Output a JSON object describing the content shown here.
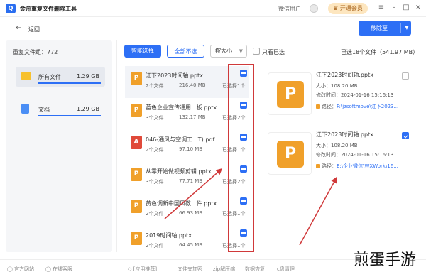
{
  "titlebar": {
    "app_title": "金舟重复文件删除工具",
    "logo_text": "Q",
    "user_label": "微信用户",
    "vip_label": "开通会员",
    "icons": [
      "menu-icon",
      "minimize-icon",
      "maximize-icon",
      "close-icon"
    ]
  },
  "nav": {
    "back_label": "返回",
    "move_label": "移除至"
  },
  "sidebar": {
    "dup_count": "重复文件组：772",
    "categories": [
      {
        "label": "所有文件",
        "size": "1.29 GB",
        "icon": "folder-icon",
        "progress": 1.0
      },
      {
        "label": "文档",
        "size": "1.29 GB",
        "icon": "document-icon",
        "progress": 1.0
      }
    ]
  },
  "toolbar": {
    "smart_select": "智能选择",
    "deselect_all": "全部不选",
    "sort_by": "按大小",
    "only_selected": "只看已选",
    "summary": "已选18个文件（541.97 MB）"
  },
  "files": [
    {
      "name": "江下2023时间轴.pptx",
      "count": "2个文件",
      "size": "216.40 MB",
      "selected": "已选择1个",
      "type": "ppt"
    },
    {
      "name": "蓝色企业宣传通用...板.pptx",
      "count": "3个文件",
      "size": "132.17 MB",
      "selected": "已选择2个",
      "type": "ppt"
    },
    {
      "name": "046-通风与空调工...T).pdf",
      "count": "2个文件",
      "size": "97.10 MB",
      "selected": "已选择1个",
      "type": "pdf"
    },
    {
      "name": "从零开始做视频剪辑.pptx",
      "count": "3个文件",
      "size": "77.71 MB",
      "selected": "已选择2个",
      "type": "ppt"
    },
    {
      "name": "黄色调新中国风教...件.pptx",
      "count": "2个文件",
      "size": "66.93 MB",
      "selected": "已选择1个",
      "type": "ppt"
    },
    {
      "name": "2019时间轴.pptx",
      "count": "2个文件",
      "size": "64.45 MB",
      "selected": "已选择1个",
      "type": "ppt"
    }
  ],
  "details": [
    {
      "name": "江下2023时间轴.pptx",
      "size": "大小：108.20 MB",
      "modified": "修改时间：2024-01-16 15:16:13",
      "path_label": "路径：",
      "path": "F:\\jzsoftmove\\江下2023...",
      "checked": false
    },
    {
      "name": "江下2023时间轴.pptx",
      "size": "大小：108.20 MB",
      "modified": "修改时间：2024-01-16 15:16:13",
      "path_label": "路径：",
      "path": "E:\\企业微信\\WXWork\\16...",
      "checked": true
    }
  ],
  "footer": {
    "items": [
      "官方网站",
      "在线客服",
      "[应用推荐]",
      "文件夹加密",
      "zip解压缩",
      "数据恢复",
      "c盘清理"
    ],
    "watermark": "煎蛋手游"
  },
  "colors": {
    "accent": "#2d6ff5",
    "highlight_box": "#d0393a",
    "ppt": "#f0a02a",
    "pdf": "#e04a3a",
    "folder": "#f7c12e"
  }
}
